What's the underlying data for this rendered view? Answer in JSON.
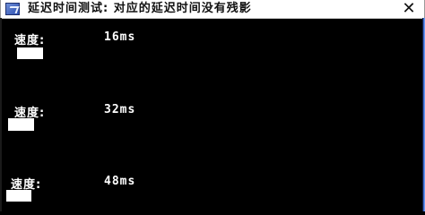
{
  "window": {
    "title": "延迟时间测试: 对应的延迟时间没有残影",
    "icon": "app-icon",
    "close_symbol": "✕"
  },
  "rows": [
    {
      "label": "速度:",
      "value": "16ms"
    },
    {
      "label": "速度:",
      "value": "32ms"
    },
    {
      "label": "速度:",
      "value": "48ms"
    }
  ],
  "colors": {
    "background": "#000000",
    "text": "#ffffff",
    "titlebar": "#ffffff"
  }
}
